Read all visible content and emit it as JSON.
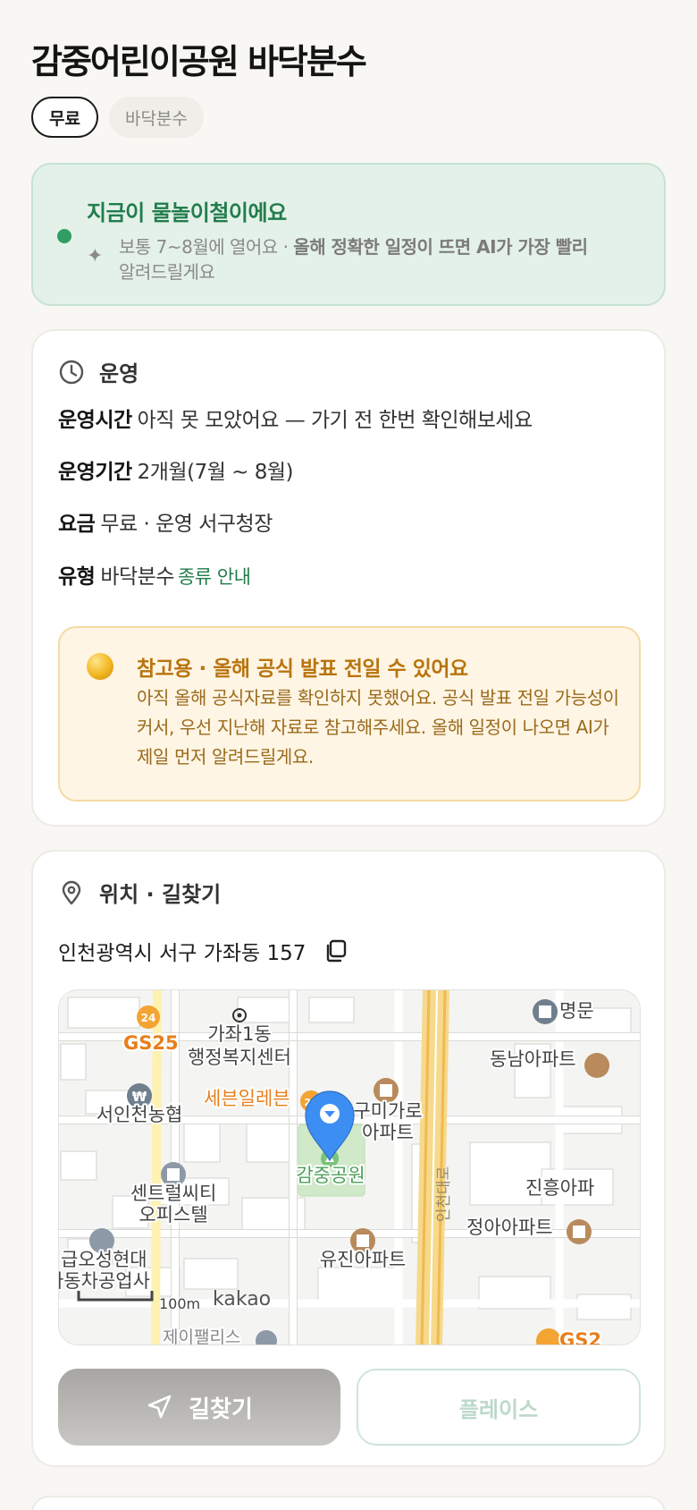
{
  "title": "감중어린이공원 바닥분수",
  "chips": [
    "무료",
    "바닥분수"
  ],
  "season": {
    "headline": "지금이 물놀이철이에요",
    "sub_normal": "보통 7~8월에 열어요 · ",
    "sub_bold": "올해 정확한 일정이 뜨면 AI가 가장 빨리",
    "sub_line2": "알려드릴게요"
  },
  "operation": {
    "section_label": "운영",
    "hours_key": "운영시간",
    "hours_value": "아직 못 모았어요 — 가기 전 한번 확인해보세요",
    "period_key": "운영기간",
    "period_value": "2개월(7월 ~ 8월)",
    "fee_key": "요금",
    "fee_value": "무료 · 운영 서구청장",
    "type_key": "유형",
    "type_value": "바닥분수",
    "type_link": "종류 안내"
  },
  "notice": {
    "headline": "참고용 · 올해 공식 발표 전일 수 있어요",
    "body": "아직 올해 공식자료를 확인하지 못했어요. 공식 발표 전일 가능성이 커서, 우선 지난해 자료로 참고해주세요. 올해 일정이 나오면 AI가 제일 먼저 알려드릴게요."
  },
  "location": {
    "section_label": "위치 · 길찾기",
    "address": "인천광역시 서구 가좌동 157"
  },
  "map": {
    "labels": {
      "gs25": "GS25",
      "gs25_right": "GS2",
      "center_line1": "가좌1동",
      "center_line2": "행정복지센터",
      "seven": "세븐일레븐",
      "bank": "서인천농협",
      "apt_line1": "구미가로",
      "apt_line2": "아파트",
      "park": "감중공원",
      "central_line1": "센트럴씨티",
      "central_line2": "오피스텔",
      "gas_line1": "급오성현대",
      "gas_line2": "자동차공업사",
      "yujin": "유진아파트",
      "jinheung": "진흥아파",
      "jeonga": "정아아파트",
      "dongnam": "동남아파트",
      "myeongmun": "명문",
      "road": "인천대로",
      "bottom": "제이팰리스",
      "scale": "100m",
      "brand": "kakao"
    },
    "colors": {
      "marker": "#3d8ef3",
      "park": "#cfe9c9",
      "road_main": "#f3c56a",
      "road_minor": "#ffffff"
    }
  },
  "buttons": {
    "navigate": "길찾기",
    "place": "플레이스"
  }
}
